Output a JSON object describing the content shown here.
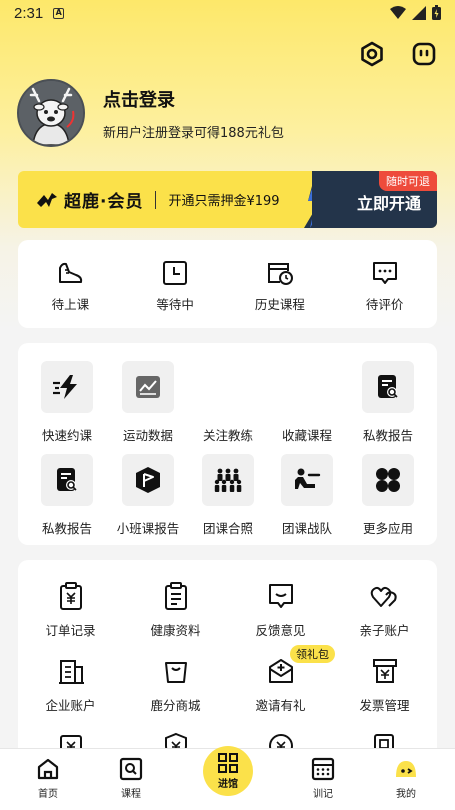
{
  "status_bar": {
    "time": "2:31",
    "indicator": "A"
  },
  "profile": {
    "login_title": "点击登录",
    "login_subtitle": "新用户注册登录可得188元礼包"
  },
  "member_banner": {
    "brand": "超鹿·会员",
    "deposit_text": "开通只需押金¥199",
    "cta": "立即开通",
    "tag": "随时可退"
  },
  "course_status": [
    {
      "label": "待上课",
      "icon": "sneaker-icon"
    },
    {
      "label": "等待中",
      "icon": "clock-icon"
    },
    {
      "label": "历史课程",
      "icon": "history-calendar-icon"
    },
    {
      "label": "待评价",
      "icon": "comment-icon"
    }
  ],
  "tools": {
    "row1": [
      {
        "label": "快速约课",
        "icon": "lightning-icon"
      },
      {
        "label": "运动数据",
        "icon": "chart-icon"
      },
      {
        "label": "关注教练",
        "icon": ""
      },
      {
        "label": "收藏课程",
        "icon": ""
      },
      {
        "label": "私教报告",
        "icon": "report-icon"
      }
    ],
    "row2": [
      {
        "label": "私教报告",
        "icon": "report-icon"
      },
      {
        "label": "小班课报告",
        "icon": "flag-icon"
      },
      {
        "label": "团课合照",
        "icon": "group-photo-icon"
      },
      {
        "label": "团课战队",
        "icon": "team-icon"
      },
      {
        "label": "更多应用",
        "icon": "apps-icon"
      }
    ]
  },
  "services": {
    "row1": [
      {
        "label": "订单记录",
        "icon": "order-icon"
      },
      {
        "label": "健康资料",
        "icon": "clipboard-icon"
      },
      {
        "label": "反馈意见",
        "icon": "feedback-icon"
      },
      {
        "label": "亲子账户",
        "icon": "hearts-icon"
      }
    ],
    "row2": [
      {
        "label": "企业账户",
        "icon": "building-icon"
      },
      {
        "label": "鹿分商城",
        "icon": "bag-icon"
      },
      {
        "label": "邀请有礼",
        "icon": "invite-icon",
        "badge": "领礼包"
      },
      {
        "label": "发票管理",
        "icon": "invoice-icon"
      }
    ]
  },
  "tabbar": [
    {
      "label": "首页",
      "icon": "home-icon"
    },
    {
      "label": "课程",
      "icon": "search-icon"
    },
    {
      "label": "进馆",
      "icon": "qr-icon"
    },
    {
      "label": "训记",
      "icon": "calendar-icon"
    },
    {
      "label": "我的",
      "icon": "mine-icon"
    }
  ]
}
